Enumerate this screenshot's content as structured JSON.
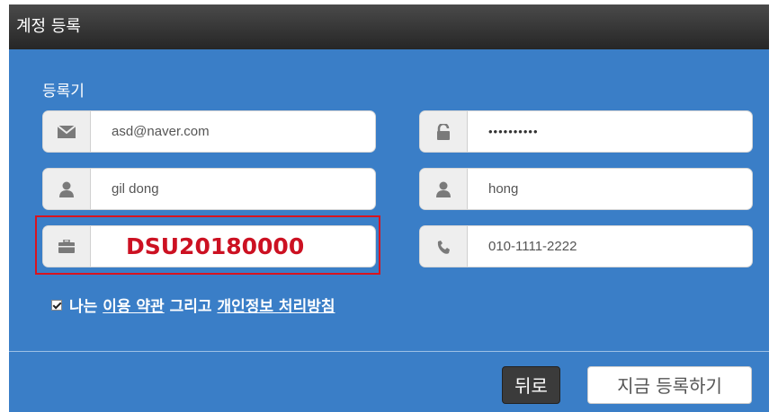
{
  "dialog": {
    "title": "계정 등록",
    "section_label": "등록기"
  },
  "form": {
    "email": {
      "icon": "envelope-icon",
      "value": "asd@naver.com"
    },
    "password": {
      "icon": "lock-icon",
      "value": "••••••••••"
    },
    "first_name": {
      "icon": "user-icon",
      "value": "gil dong"
    },
    "last_name": {
      "icon": "user-icon",
      "value": "hong"
    },
    "student_id": {
      "icon": "briefcase-icon",
      "value": "DSU20180000"
    },
    "phone": {
      "icon": "phone-icon",
      "value": "010-1111-2222"
    }
  },
  "agreement": {
    "checked": true,
    "prefix": "나는",
    "terms_link": "이용 약관",
    "conjunction": "그리고",
    "privacy_link": "개인정보 처리방침"
  },
  "buttons": {
    "back_label": "뒤로",
    "register_label": "지금 등록하기"
  },
  "colors": {
    "dialog_bg": "#3a7ec7",
    "highlight": "#d8141f",
    "student_id_text": "#cc1122"
  }
}
